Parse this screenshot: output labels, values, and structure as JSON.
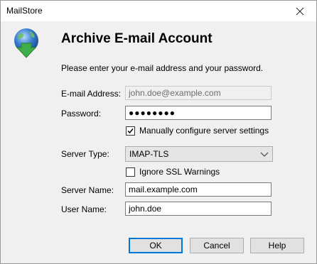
{
  "window": {
    "title": "MailStore"
  },
  "header": {
    "title": "Archive E-mail Account",
    "instruction": "Please enter your e-mail address and your password."
  },
  "form": {
    "email_label": "E-mail Address:",
    "email_value": "john.doe@example.com",
    "password_label": "Password:",
    "password_value": "●●●●●●●●",
    "manual_config_label": "Manually configure server settings",
    "manual_config_checked": true,
    "server_type_label": "Server Type:",
    "server_type_value": "IMAP-TLS",
    "ignore_ssl_label": "Ignore SSL Warnings",
    "ignore_ssl_checked": false,
    "server_name_label": "Server Name:",
    "server_name_value": "mail.example.com",
    "user_name_label": "User Name:",
    "user_name_value": "john.doe"
  },
  "buttons": {
    "ok": "OK",
    "cancel": "Cancel",
    "help": "Help"
  },
  "icons": {
    "close": "close-icon",
    "logo": "globe-download-icon",
    "chevron": "chevron-down-icon",
    "check": "checkmark-icon"
  },
  "colors": {
    "accent": "#0078d7",
    "globe": "#3a7fd0",
    "arrow": "#3fae49"
  }
}
